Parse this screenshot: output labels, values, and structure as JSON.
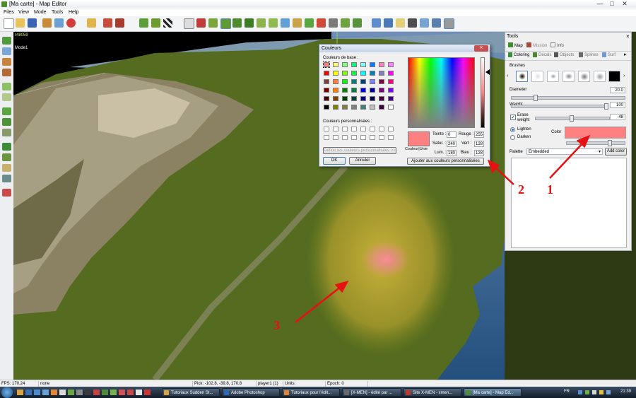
{
  "window": {
    "title": "[Ma carte] - Map Editor",
    "minimize": "—",
    "maximize": "□",
    "close": "✕"
  },
  "menu": [
    "Files",
    "View",
    "Mode",
    "Tools",
    "Help"
  ],
  "viewport": {
    "id_label": "r48059",
    "mode_label": "Mode1"
  },
  "tools_panel": {
    "title": "Tools",
    "close": "×",
    "tabs": [
      "Map",
      "Mission",
      "Info"
    ],
    "subtabs": [
      "Coloring",
      "Decals",
      "Objects",
      "Splines",
      "Surf"
    ],
    "brushes_label": "Brushes",
    "diameter": {
      "label": "Diameter",
      "value": "20.0",
      "fraction": 0.2
    },
    "weight": {
      "label": "Weight",
      "value": "100",
      "fraction": 1.0
    },
    "erase_weight": {
      "label": "Erase weight",
      "value": "48",
      "fraction": 0.48,
      "checked": true
    },
    "lighten_label": "Lighten",
    "darken_label": "Darken",
    "mode_selected": "Lighten",
    "color_label": "Color",
    "color_value": "#ff8080",
    "palette": {
      "label": "Palette",
      "selected": "Embedded",
      "add_button": "Add color"
    }
  },
  "color_dialog": {
    "title": "Couleurs",
    "close": "✕",
    "basic_label": "Couleurs de base :",
    "custom_label": "Couleurs personnalisées :",
    "define_button": "Définir les couleurs personnalisées >>",
    "ok": "OK",
    "cancel": "Annuler",
    "add_custom_button": "Ajouter aux couleurs personnalisées",
    "solid_label": "Couleur|Unie",
    "preview_color": "#ff8080",
    "fields": {
      "teinte": {
        "label": "Teinte :",
        "value": "0"
      },
      "satur": {
        "label": "Satur. :",
        "value": "240"
      },
      "lum": {
        "label": "Lum. :",
        "value": "180"
      },
      "rouge": {
        "label": "Rouge :",
        "value": "255"
      },
      "vert": {
        "label": "Vert :",
        "value": "128"
      },
      "bleu": {
        "label": "Bleu :",
        "value": "128"
      }
    },
    "basic_colors": [
      "#ff8080",
      "#ffff80",
      "#80ff80",
      "#00ff80",
      "#80ffff",
      "#0080ff",
      "#ff80c0",
      "#ff80ff",
      "#ff0000",
      "#ffff00",
      "#80ff00",
      "#00ff40",
      "#00ffff",
      "#0080c0",
      "#8080c0",
      "#ff00ff",
      "#804040",
      "#ff8040",
      "#00ff00",
      "#008080",
      "#004080",
      "#8080ff",
      "#800040",
      "#ff0080",
      "#800000",
      "#ff8000",
      "#008000",
      "#008040",
      "#0000ff",
      "#0000a0",
      "#800080",
      "#8000ff",
      "#400000",
      "#804000",
      "#004000",
      "#004040",
      "#000080",
      "#000040",
      "#400040",
      "#400080",
      "#000000",
      "#808000",
      "#808040",
      "#808080",
      "#408080",
      "#c0c0c0",
      "#400040",
      "#ffffff"
    ]
  },
  "annotations": [
    "1",
    "2",
    "3"
  ],
  "status": {
    "fps": "FPS: 170.24",
    "none": "none",
    "pick": "Pick: -102.8, -39.8, 170.8",
    "player": "player1 (1)",
    "units": "Units:",
    "epoch": "Epoch: 0"
  },
  "taskbar": {
    "items": [
      "Tutoriaux Sudden St...",
      "Adobe Photoshop",
      "Tutoriaux pour l'édit...",
      "[X-MEN] - édité par ...",
      "Site X-MEN - xmen...",
      "[Ma carte] - Map Ed..."
    ],
    "lang": "FR",
    "clock": "21:39"
  }
}
